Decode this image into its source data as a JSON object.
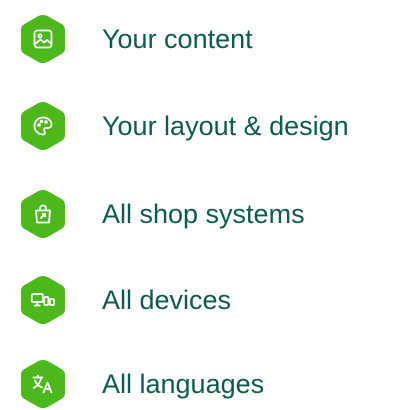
{
  "brand": {
    "accent": "#4cb81c",
    "text_color": "#0e5a4f"
  },
  "features": [
    {
      "label": "Your content",
      "icon": "image-icon"
    },
    {
      "label": "Your layout & design",
      "icon": "palette-icon"
    },
    {
      "label": "All shop systems",
      "icon": "shopping-bag-icon"
    },
    {
      "label": "All devices",
      "icon": "devices-icon"
    },
    {
      "label": "All languages",
      "icon": "translate-icon"
    }
  ]
}
